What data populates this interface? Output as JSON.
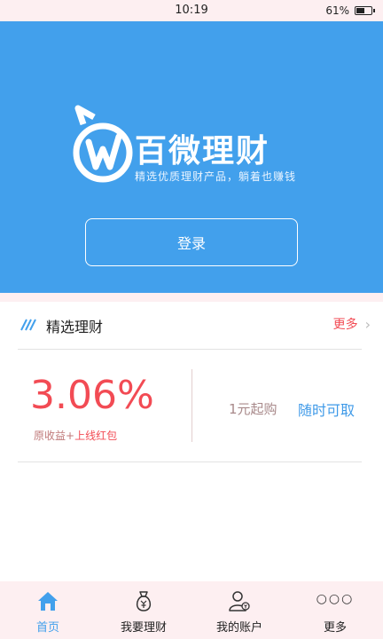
{
  "status_bar": {
    "time": "10:19",
    "battery": "61%",
    "battery_level": 0.61
  },
  "hero": {
    "brand_name": "百微理财",
    "tagline": "精选优质理财产品，躺着也赚钱",
    "login_label": "登录"
  },
  "section": {
    "title": "精选理财",
    "more_label": "更多"
  },
  "product": {
    "rate": "3.06%",
    "base_label": "原收益+",
    "bonus_label": "上线红包",
    "min_buy": "1元起购",
    "redeem": "随时可取"
  },
  "nav": {
    "items": [
      {
        "label": "首页",
        "icon": "home-icon",
        "active": true
      },
      {
        "label": "我要理财",
        "icon": "money-bag-icon",
        "active": false
      },
      {
        "label": "我的账户",
        "icon": "user-icon",
        "active": false
      },
      {
        "label": "更多",
        "icon": "more-dots-icon",
        "active": false
      }
    ]
  },
  "colors": {
    "primary": "#42a0ec",
    "accent": "#f24b54",
    "tint": "#fdeff1"
  }
}
